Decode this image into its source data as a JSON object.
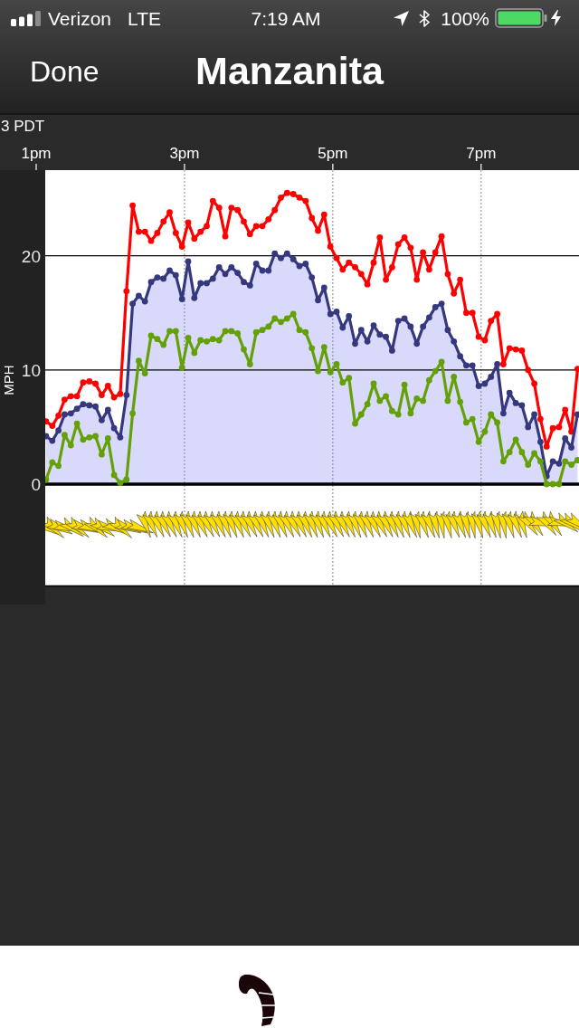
{
  "status_bar": {
    "carrier": "Verizon",
    "network": "LTE",
    "time": "7:19 AM",
    "battery": "100%"
  },
  "nav_bar": {
    "done_button": "Done",
    "title": "Manzanita"
  },
  "chart": {
    "axis_caption": "3 PDT",
    "chart_data": {
      "type": "line",
      "ylabel": "MPH",
      "grid": true,
      "x": [
        1.133,
        1.217,
        1.3,
        1.383,
        1.467,
        1.55,
        1.633,
        1.717,
        1.8,
        1.883,
        1.967,
        2.05,
        2.133,
        2.217,
        2.3,
        2.383,
        2.467,
        2.55,
        2.633,
        2.717,
        2.8,
        2.883,
        2.967,
        3.05,
        3.133,
        3.217,
        3.3,
        3.383,
        3.467,
        3.55,
        3.633,
        3.717,
        3.8,
        3.883,
        3.967,
        4.05,
        4.133,
        4.217,
        4.3,
        4.383,
        4.467,
        4.55,
        4.633,
        4.717,
        4.8,
        4.883,
        4.967,
        5.05,
        5.133,
        5.217,
        5.3,
        5.383,
        5.467,
        5.55,
        5.633,
        5.717,
        5.8,
        5.883,
        5.967,
        6.05,
        6.133,
        6.217,
        6.3,
        6.383,
        6.467,
        6.55,
        6.633,
        6.717,
        6.8,
        6.883,
        6.967,
        7.05,
        7.133,
        7.217,
        7.3,
        7.383,
        7.467,
        7.55,
        7.633,
        7.717,
        7.8,
        7.883,
        7.967,
        8.05,
        8.133,
        8.217,
        8.3
      ],
      "xticks": [
        {
          "value": 1,
          "label": "1pm"
        },
        {
          "value": 3,
          "label": "3pm"
        },
        {
          "value": 5,
          "label": "5pm"
        },
        {
          "value": 7,
          "label": "7pm"
        }
      ],
      "yticks": [
        0,
        10,
        20
      ],
      "xlim": [
        1,
        8.32
      ],
      "ylim": [
        0,
        27.5
      ],
      "series": [
        {
          "color": "#ff0000",
          "marker": "circle",
          "values": [
            5.5,
            5.1,
            6.0,
            7.4,
            7.7,
            7.7,
            8.9,
            9.0,
            8.8,
            7.8,
            8.6,
            7.6,
            7.9,
            16.9,
            24.4,
            22.1,
            22.1,
            21.3,
            22.0,
            23.0,
            23.8,
            22.0,
            20.8,
            22.9,
            21.5,
            22.1,
            22.6,
            24.8,
            24.2,
            21.7,
            24.2,
            24.0,
            23.0,
            21.9,
            22.6,
            22.6,
            23.2,
            24.0,
            25.1,
            25.5,
            25.4,
            25.1,
            24.8,
            23.3,
            22.2,
            23.6,
            20.8,
            19.8,
            18.8,
            19.4,
            19.0,
            18.4,
            17.5,
            19.4,
            21.6,
            17.9,
            19.0,
            21.0,
            21.6,
            20.7,
            17.9,
            20.3,
            18.8,
            20.3,
            21.7,
            18.4,
            16.7,
            17.9,
            15.0,
            15.0,
            12.9,
            12.6,
            14.3,
            14.9,
            10.5,
            11.9,
            11.8,
            11.7,
            10.0,
            8.8,
            5.7,
            3.3,
            4.9,
            5.0,
            6.5,
            4.6,
            10.1
          ]
        },
        {
          "type": "area",
          "color": "#35387c",
          "marker": "circle",
          "values": [
            4.2,
            3.8,
            4.7,
            6.1,
            6.2,
            6.6,
            7.0,
            6.9,
            6.8,
            5.6,
            6.5,
            4.9,
            4.1,
            7.8,
            15.8,
            16.5,
            16.0,
            17.7,
            18.1,
            18.0,
            18.7,
            18.3,
            16.2,
            19.5,
            16.3,
            17.6,
            17.6,
            18.0,
            19.0,
            18.4,
            19.0,
            18.5,
            17.7,
            17.4,
            19.3,
            18.7,
            18.7,
            20.2,
            19.8,
            20.2,
            19.7,
            19.1,
            19.3,
            18.1,
            16.1,
            17.2,
            14.9,
            15.1,
            13.7,
            14.7,
            12.3,
            13.5,
            12.5,
            13.9,
            13.1,
            12.9,
            11.7,
            14.3,
            14.5,
            13.8,
            12.3,
            13.8,
            14.6,
            15.5,
            15.8,
            13.5,
            12.5,
            11.2,
            10.4,
            10.4,
            8.6,
            8.8,
            9.4,
            10.5,
            6.2,
            8.0,
            7.1,
            6.9,
            5.0,
            6.1,
            3.7,
            0.7,
            2.0,
            1.8,
            4.0,
            3.2,
            6.1
          ]
        },
        {
          "color": "#64a008",
          "marker": "circle",
          "values": [
            0.4,
            1.9,
            1.6,
            4.3,
            3.4,
            5.3,
            3.9,
            4.1,
            4.2,
            2.6,
            4.0,
            0.8,
            0.1,
            0.4,
            6.2,
            10.8,
            9.7,
            13.0,
            12.7,
            12.2,
            13.4,
            13.4,
            10.2,
            12.8,
            11.5,
            12.6,
            12.5,
            12.7,
            12.6,
            13.4,
            13.4,
            13.2,
            11.8,
            10.5,
            13.3,
            13.5,
            13.8,
            14.5,
            14.2,
            14.5,
            14.9,
            13.5,
            13.3,
            11.9,
            9.9,
            12.0,
            9.8,
            10.5,
            8.9,
            9.3,
            5.3,
            6.1,
            7.0,
            8.8,
            7.3,
            7.7,
            6.4,
            6.1,
            8.7,
            6.2,
            7.5,
            7.3,
            9.1,
            9.9,
            10.7,
            7.3,
            9.4,
            7.2,
            5.4,
            5.7,
            3.7,
            4.6,
            6.1,
            5.4,
            2.0,
            2.8,
            3.9,
            2.8,
            1.7,
            2.7,
            2.0,
            0,
            0,
            0,
            2.0,
            1.7,
            2.1
          ]
        }
      ]
    }
  }
}
